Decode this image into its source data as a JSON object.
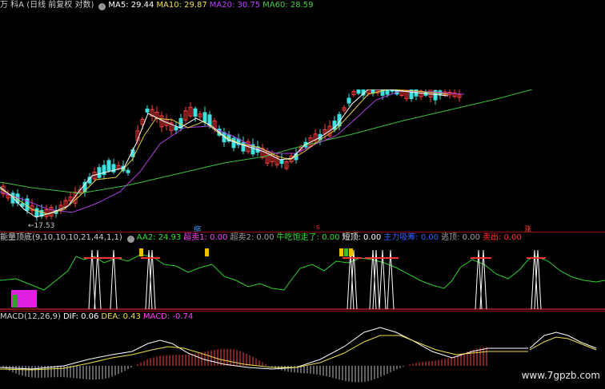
{
  "main": {
    "title": "万 科A (日线 前复权 对数)",
    "ma": [
      {
        "label": "MA5: 29.44",
        "color": "#ffffff"
      },
      {
        "label": "MA10: 29.87",
        "color": "#f0e050"
      },
      {
        "label": "MA20: 30.75",
        "color": "#c040ff"
      },
      {
        "label": "MA60: 28.59",
        "color": "#40d040"
      }
    ],
    "low_label": "←17.53",
    "markers": [
      {
        "text": "缩",
        "color": "#3aa0ff"
      },
      {
        "text": "s",
        "color": "#ff3030"
      },
      {
        "text": "涨",
        "color": "#ff4040"
      }
    ]
  },
  "indicator": {
    "name": "能量顶底(9,10,10,10,21,44,1,1)",
    "items": [
      {
        "label": "AA2: 24.93",
        "color": "#30e030"
      },
      {
        "label": "超卖1: 0.00",
        "color": "#ff40ff"
      },
      {
        "label": "超卖2: 0.00",
        "color": "#a0a0a0"
      },
      {
        "label": "牛吃饱走了: 0.00",
        "color": "#30e030"
      },
      {
        "label": "短顶: 0.00",
        "color": "#ffffff"
      },
      {
        "label": "主力吸筹: 0.00",
        "color": "#3060ff"
      },
      {
        "label": "逃顶: 0.00",
        "color": "#a0a0a0"
      },
      {
        "label": "卖出: 0.00",
        "color": "#ff3030"
      }
    ]
  },
  "macd": {
    "name": "MACD(12,26,9)",
    "dif": "DIF: 0.06",
    "dea": "DEA: 0.43",
    "macd": "MACD: -0.74"
  },
  "watermark": "www.7gpzb.com"
}
